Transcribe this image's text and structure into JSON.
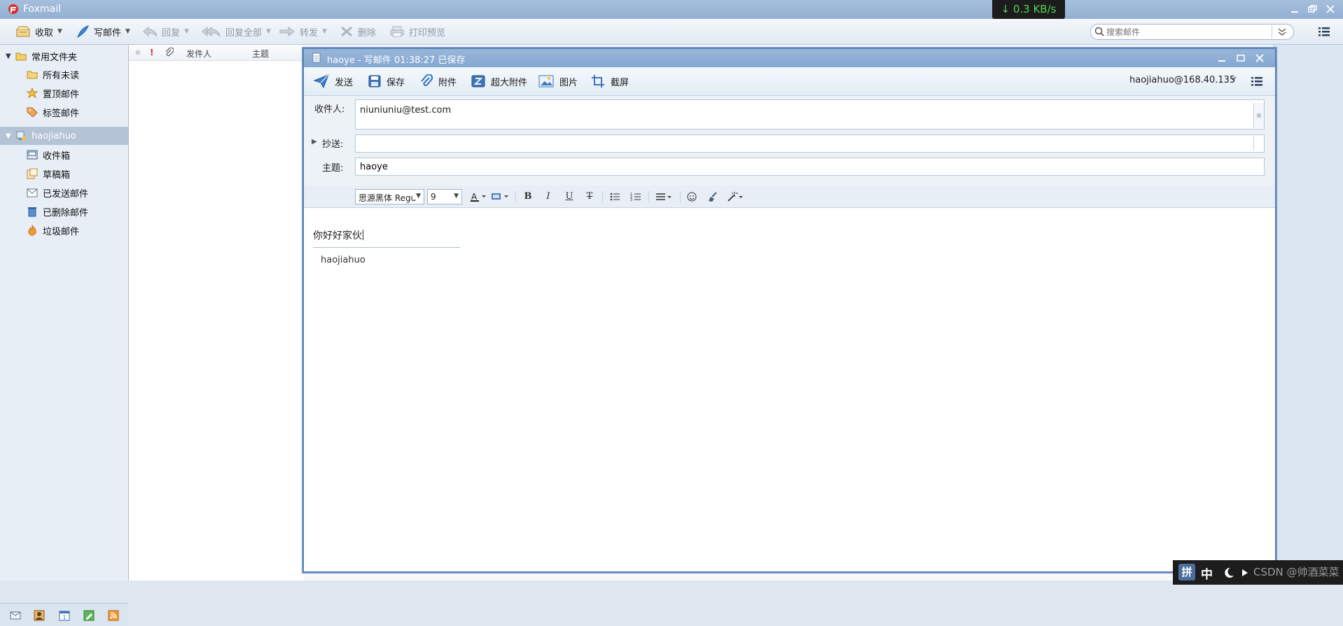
{
  "app": {
    "title": "Foxmail",
    "net_speed": "↓ 0.3 KB/s"
  },
  "toolbar": {
    "receive": "收取",
    "compose": "写邮件",
    "reply": "回复",
    "reply_all": "回复全部",
    "forward": "转发",
    "delete": "删除",
    "print_preview": "打印预览"
  },
  "search": {
    "placeholder": "搜索邮件"
  },
  "sidebar": {
    "common_folders": "常用文件夹",
    "common_items": [
      "所有未读",
      "置顶邮件",
      "标签邮件"
    ],
    "account": "haojiahuo",
    "account_items": [
      "收件箱",
      "草稿箱",
      "已发送邮件",
      "已删除邮件",
      "垃圾邮件"
    ]
  },
  "list": {
    "col_sender": "发件人",
    "col_subject": "主题"
  },
  "compose": {
    "title": "haoye - 写邮件   01:38:27 已保存",
    "toolbar": {
      "send": "发送",
      "save": "保存",
      "attach": "附件",
      "large_attach": "超大附件",
      "image": "图片",
      "screenshot": "截屏"
    },
    "account": "haojiahuo@168.40.135",
    "to_label": "收件人:",
    "to_value": "niuniuniu@test.com",
    "cc_label": "抄送:",
    "cc_value": "",
    "subject_label": "主题:",
    "subject_value": "haoye",
    "font_name": "思源黑体 Regu",
    "font_size": "9",
    "body": "你好好家伙",
    "signature": "haojiahuo"
  },
  "tray": {
    "ime": "拼",
    "lang": "中",
    "watermark": "CSDN @帅酒菜菜"
  },
  "colors": {
    "titlebar": "#93b0d3",
    "compose_border": "#4f7bb0",
    "selected": "#b4c4d6"
  }
}
